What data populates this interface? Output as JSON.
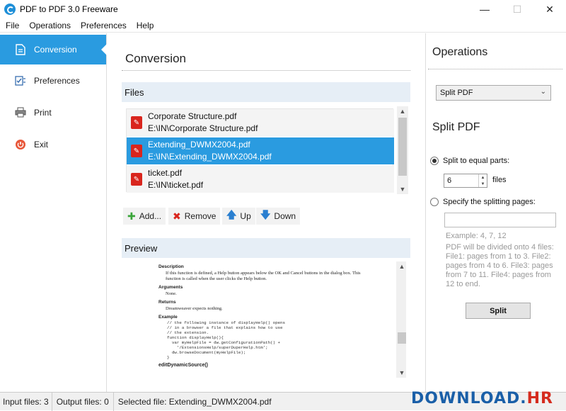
{
  "window": {
    "title": "PDF to PDF 3.0 Freeware",
    "minimize_icon": "minimize-icon",
    "maximize_icon": "maximize-icon",
    "close_icon": "close-icon"
  },
  "menu": [
    "File",
    "Operations",
    "Preferences",
    "Help"
  ],
  "sidebar": {
    "items": [
      {
        "label": "Conversion",
        "icon": "document-edit-icon",
        "active": true
      },
      {
        "label": "Preferences",
        "icon": "checklist-icon",
        "active": false
      },
      {
        "label": "Print",
        "icon": "printer-icon",
        "active": false
      },
      {
        "label": "Exit",
        "icon": "power-icon",
        "active": false
      }
    ]
  },
  "main": {
    "title": "Conversion",
    "files_header": "Files",
    "files": [
      {
        "name": "Corporate Structure.pdf",
        "path": "E:\\IN\\Corporate Structure.pdf",
        "selected": false
      },
      {
        "name": "Extending_DWMX2004.pdf",
        "path": "E:\\IN\\Extending_DWMX2004.pdf",
        "selected": true
      },
      {
        "name": "ticket.pdf",
        "path": "E:\\IN\\ticket.pdf",
        "selected": false
      }
    ],
    "buttons": {
      "add": "Add...",
      "remove": "Remove",
      "up": "Up",
      "down": "Down"
    },
    "preview_header": "Preview",
    "preview": {
      "description_head": "Description",
      "description_text": "If this function is defined, a Help button appears below the OK and Cancel buttons in the dialog box. This function is called when the user clicks the Help button.",
      "arguments_head": "Arguments",
      "arguments_text": "None.",
      "returns_head": "Returns",
      "returns_text": "Dreamweaver expects nothing.",
      "example_head": "Example",
      "example_code": "// the following instance of displayHelp() opens\n// in a browser a file that explains how to use\n// the extension.\nfunction displayHelp(){\n  var myHelpFile = dw.getConfigurationPath() +\n    '/ExtensionsHelp/superDuperHelp.htm';\n  dw.browseDocument(myHelpFile);\n}",
      "next_head": "editDynamicSource()"
    }
  },
  "operations": {
    "title": "Operations",
    "select_value": "Split PDF",
    "split_title": "Split PDF",
    "option_equal": "Split to equal parts:",
    "equal_value": "6",
    "files_label": "files",
    "option_specify": "Specify the splitting pages:",
    "pages_value": "",
    "example_hint": "Example: 4, 7, 12",
    "info_hint": "PDF will be divided onto 4 files: File1: pages from 1 to 3. File2: pages from 4 to 6. File3: pages from 7 to 11. File4: pages from 12 to end.",
    "split_button": "Split"
  },
  "status": {
    "input_files": "Input files: 3",
    "output_files": "Output files: 0",
    "selected_file": "Selected file: Extending_DWMX2004.pdf"
  },
  "watermark": {
    "main": "DOWNLOAD.",
    "suffix": "HR"
  },
  "colors": {
    "accent": "#2a9be0",
    "header_bg": "#e6eef6",
    "pdf_red": "#d9251d"
  }
}
